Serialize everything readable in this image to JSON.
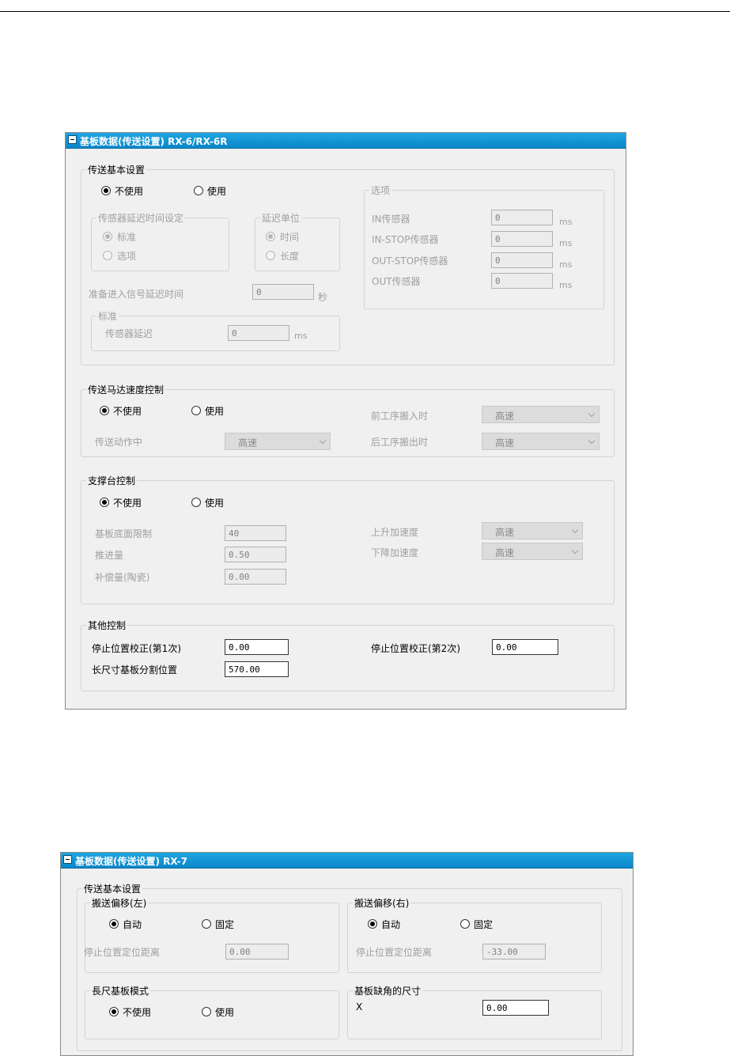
{
  "panel1": {
    "title": "基板数据(传送设置) RX-6/RX-6R",
    "basic": {
      "legend": "传送基本设置",
      "radio_off": "不使用",
      "radio_on": "使用",
      "sensor_delay": {
        "legend": "传感器延迟时间设定",
        "opt_std": "标准",
        "opt_option": "选项"
      },
      "delay_unit": {
        "legend": "延迟单位",
        "opt_time": "时间",
        "opt_length": "长度"
      },
      "ready_delay": {
        "label": "准备进入信号延迟时间",
        "value": "0",
        "unit": "秒"
      },
      "standard": {
        "legend": "标准",
        "sensor_delay_label": "传感器延迟",
        "value": "0",
        "unit": "ms"
      },
      "options": {
        "legend": "选项",
        "rows": [
          {
            "label": "IN传感器",
            "value": "0",
            "unit": "ms"
          },
          {
            "label": "IN-STOP传感器",
            "value": "0",
            "unit": "ms"
          },
          {
            "label": "OUT-STOP传感器",
            "value": "0",
            "unit": "ms"
          },
          {
            "label": "OUT传感器",
            "value": "0",
            "unit": "ms"
          }
        ]
      }
    },
    "motor": {
      "legend": "传送马达速度控制",
      "radio_off": "不使用",
      "radio_on": "使用",
      "during_label": "传送动作中",
      "during_value": "高速",
      "prev_label": "前工序搬入时",
      "prev_value": "高速",
      "next_label": "后工序搬出时",
      "next_value": "高速"
    },
    "support": {
      "legend": "支撑台控制",
      "radio_off": "不使用",
      "radio_on": "使用",
      "bottom_limit_label": "基板底面限制",
      "bottom_limit_value": "40",
      "push_label": "推进量",
      "push_value": "0.50",
      "comp_label": "补偿量(陶瓷)",
      "comp_value": "0.00",
      "up_accel_label": "上升加速度",
      "up_accel_value": "高速",
      "down_accel_label": "下降加速度",
      "down_accel_value": "高速"
    },
    "other": {
      "legend": "其他控制",
      "stop1_label": "停止位置校正(第1次)",
      "stop1_value": "0.00",
      "stop2_label": "停止位置校正(第2次)",
      "stop2_value": "0.00",
      "long_split_label": "长尺寸基板分割位置",
      "long_split_value": "570.00"
    }
  },
  "panel2": {
    "title": "基板数据(传送设置) RX-7",
    "basic_legend": "传送基本设置",
    "left": {
      "legend": "搬送偏移(左)",
      "radio_auto": "自动",
      "radio_fixed": "固定",
      "dist_label": "停止位置定位距离",
      "dist_value": "0.00"
    },
    "right": {
      "legend": "搬送偏移(右)",
      "radio_auto": "自动",
      "radio_fixed": "固定",
      "dist_label": "停止位置定位距离",
      "dist_value": "-33.00"
    },
    "long_mode": {
      "legend": "長尺基板模式",
      "radio_off": "不使用",
      "radio_on": "使用"
    },
    "notch": {
      "legend": "基板缺角的尺寸",
      "x_label": "X",
      "x_value": "0.00"
    }
  }
}
